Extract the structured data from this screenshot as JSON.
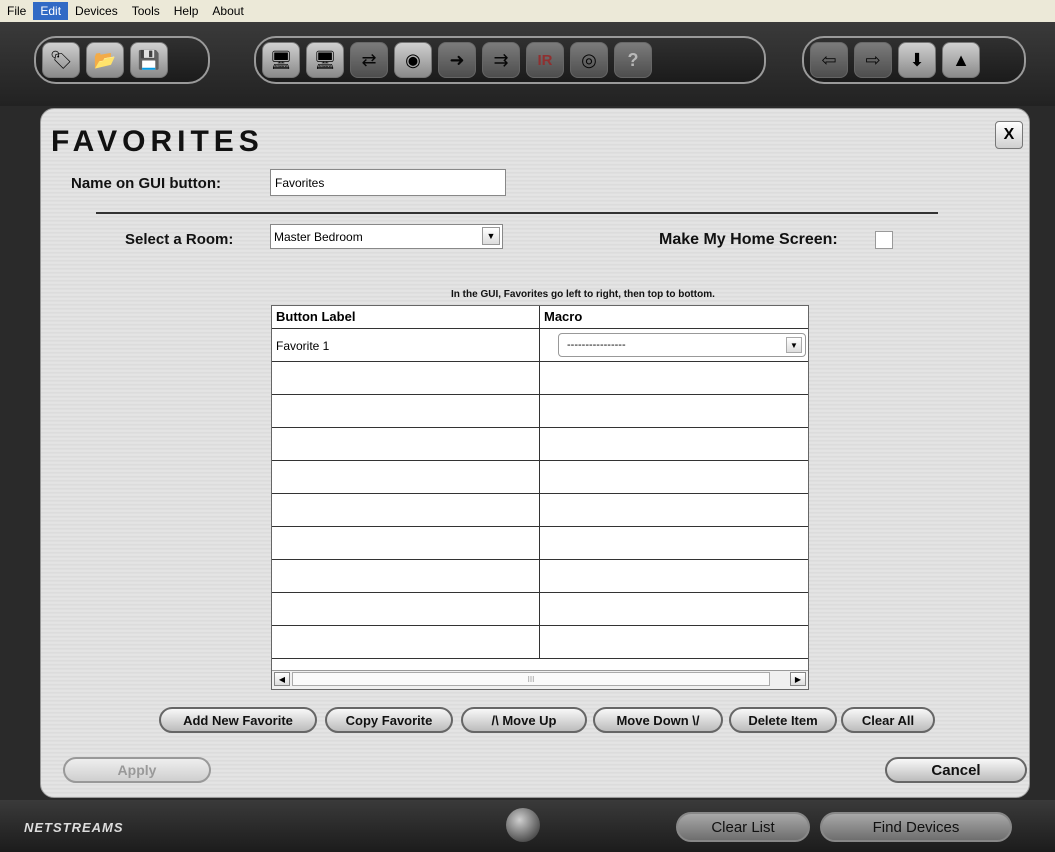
{
  "menu": [
    "File",
    "Edit",
    "Devices",
    "Tools",
    "Help",
    "About"
  ],
  "active_menu_index": 1,
  "toolbar": {
    "group1": [
      "tag-icon",
      "folder-icon",
      "save-disk-icon"
    ],
    "group2": [
      "add-device-icon",
      "edit-device-icon",
      "swap-device-icon",
      "fingerprint-icon",
      "forward-arrow-icon",
      "double-arrow-icon",
      "ir-icon",
      "target-icon",
      "help-question-icon"
    ],
    "group2_ir_text": "IR",
    "group2_help_text": "?",
    "group3": [
      "import-icon",
      "export-icon",
      "download-tray-icon",
      "wizard-hat-icon"
    ]
  },
  "dialog": {
    "title": "FAVORITES",
    "close_label": "X",
    "name_label": "Name on GUI button:",
    "name_value": "Favorites",
    "room_label": "Select a Room:",
    "room_value": "Master Bedroom",
    "home_screen_label": "Make My Home Screen:",
    "home_screen_checked": false,
    "hint": "In the GUI, Favorites go left to right, then top to bottom.",
    "table": {
      "headers": [
        "Button Label",
        "Macro"
      ],
      "rows": [
        {
          "label": "Favorite 1",
          "macro": "----------------"
        },
        {
          "label": "",
          "macro": ""
        },
        {
          "label": "",
          "macro": ""
        },
        {
          "label": "",
          "macro": ""
        },
        {
          "label": "",
          "macro": ""
        },
        {
          "label": "",
          "macro": ""
        },
        {
          "label": "",
          "macro": ""
        },
        {
          "label": "",
          "macro": ""
        },
        {
          "label": "",
          "macro": ""
        },
        {
          "label": "",
          "macro": ""
        }
      ],
      "scroll_thumb_text": "III"
    },
    "buttons": {
      "add_new": "Add New Favorite",
      "copy": "Copy Favorite",
      "move_up": "/\\ Move Up",
      "move_down": "Move Down \\/",
      "delete": "Delete Item",
      "clear_all": "Clear All",
      "apply": "Apply",
      "cancel": "Cancel"
    }
  },
  "footer": {
    "logo": "NETSTREAMS",
    "clear_list": "Clear List",
    "find_devices": "Find Devices"
  }
}
